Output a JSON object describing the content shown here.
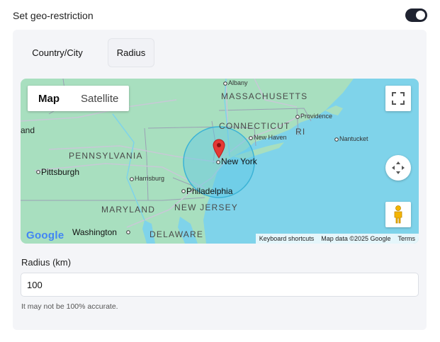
{
  "header": {
    "title": "Set geo-restriction",
    "toggle_on": true
  },
  "tabs": {
    "country_city": "Country/City",
    "radius": "Radius"
  },
  "map": {
    "type_control": {
      "map": "Map",
      "satellite": "Satellite",
      "selected": "Map"
    },
    "states": {
      "massachusetts": "MASSACHUSETTS",
      "connecticut": "CONNECTICUT",
      "ri": "RI",
      "pennsylvania": "PENNSYLVANIA",
      "new_jersey": "NEW JERSEY",
      "maryland": "MARYLAND",
      "delaware": "DELAWARE"
    },
    "cities": {
      "albany": "Albany",
      "providence": "Providence",
      "new_haven": "New Haven",
      "nantucket": "Nantucket",
      "new_york": "New York",
      "pittsburgh": "Pittsburgh",
      "harrisburg": "Harrisburg",
      "philadelphia": "Philadelphia",
      "washington": "Washington",
      "land_fragment": "and"
    },
    "google_logo": "Google",
    "attribution": {
      "shortcuts": "Keyboard shortcuts",
      "data": "Map data ©2025 Google",
      "terms": "Terms"
    },
    "icons": {
      "fullscreen": "fullscreen-icon",
      "camera": "camera-control-icon",
      "pegman": "street-view-pegman-icon",
      "marker": "location-marker-icon"
    },
    "colors": {
      "land": "#a8dfbf",
      "water": "#7fd3ea",
      "circle_fill": "#5fc8e6",
      "marker": "#e53935"
    }
  },
  "radius_field": {
    "label": "Radius (km)",
    "value": "100",
    "hint": "It may not be 100% accurate."
  }
}
